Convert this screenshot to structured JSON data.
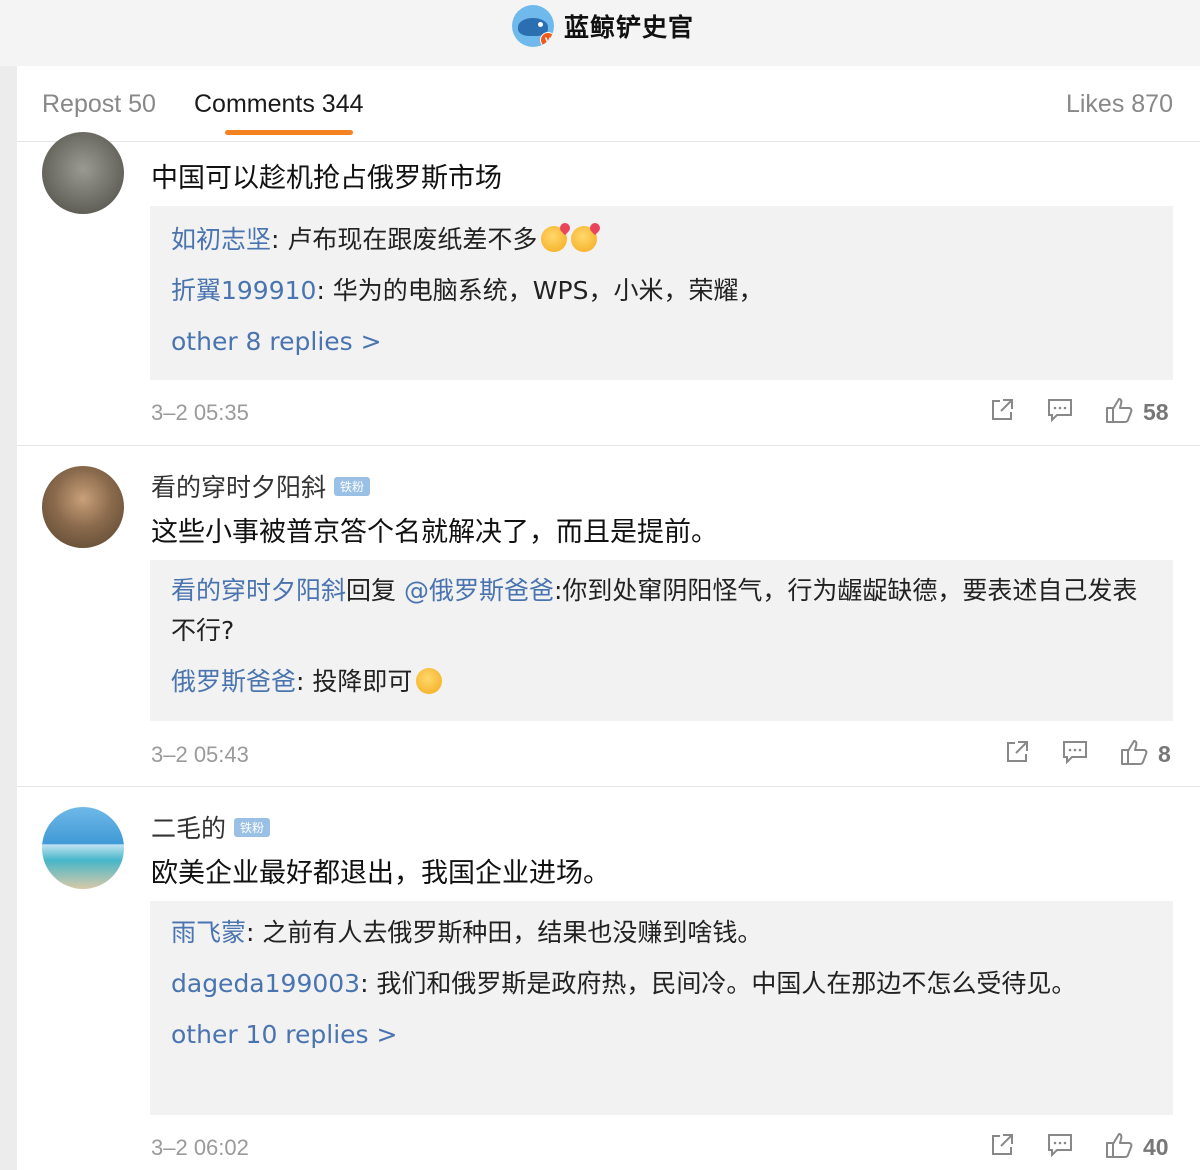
{
  "header": {
    "title": "蓝鲸铲史官"
  },
  "tabs": [
    {
      "label": "Repost 50"
    },
    {
      "label": "Comments 344"
    },
    {
      "label": "Likes 870"
    }
  ],
  "comments": [
    {
      "username": "",
      "text": "中国可以趁机抢占俄罗斯市场",
      "replies": [
        {
          "name": "如初志坚",
          "text": ": 卢布现在跟废纸差不多"
        },
        {
          "name": "折翼199910",
          "text": ": 华为的电脑系统，WPS，小米，荣耀，"
        }
      ],
      "more": "other 8 replies >",
      "time": "3–2 05:35",
      "likes": "58"
    },
    {
      "username": "看的穿时夕阳斜",
      "badge": "铁粉",
      "text": "这些小事被普京答个名就解决了，而且是提前。",
      "replies": [
        {
          "name": "看的穿时夕阳斜",
          "text": "回复 ",
          "mention": "@俄罗斯爸爸",
          "text2": ":你到处窜阴阳怪气，行为龌龊缺德，要表述自己发表不行?"
        },
        {
          "name": "俄罗斯爸爸",
          "text": ": 投降即可"
        }
      ],
      "time": "3–2 05:43",
      "likes": "8"
    },
    {
      "username": "二毛的",
      "badge": "铁粉",
      "text": "欧美企业最好都退出，我国企业进场。",
      "replies": [
        {
          "name": "雨飞蒙",
          "text": ": 之前有人去俄罗斯种田，结果也没赚到啥钱。"
        },
        {
          "name": "dageda199003",
          "text": ": 我们和俄罗斯是政府热，民间冷。中国人在那边不怎么受待见。"
        }
      ],
      "more": "other 10 replies >",
      "time": "3–2 06:02",
      "likes": "40"
    }
  ],
  "colors": {
    "accent": "#f58220",
    "link": "#4a74b0"
  }
}
